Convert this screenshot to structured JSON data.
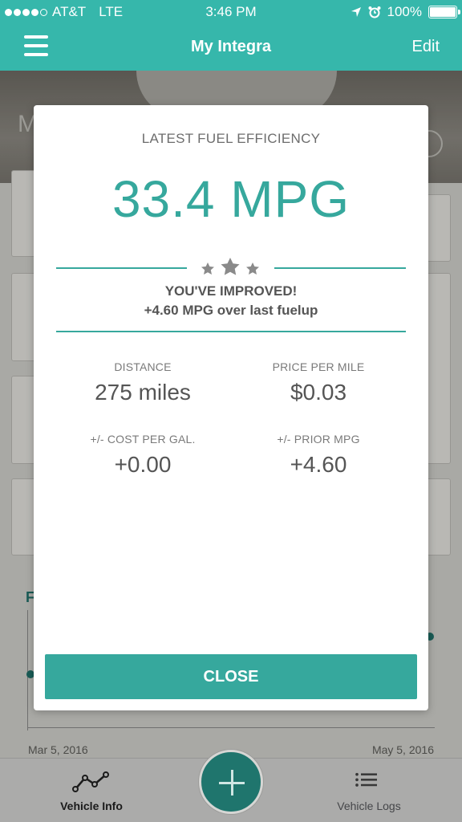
{
  "status_bar": {
    "carrier": "AT&T",
    "network": "LTE",
    "time": "3:46 PM",
    "battery": "100%",
    "location_icon": "location-arrow-icon",
    "alarm_icon": "alarm-icon"
  },
  "nav": {
    "title": "My Integra",
    "edit_label": "Edit",
    "menu_icon": "hamburger-menu-icon"
  },
  "background": {
    "hero_letter": "M",
    "chart_label": "F",
    "start_date": "Mar 5, 2016",
    "end_date": "May 5, 2016"
  },
  "modal": {
    "title": "LATEST FUEL EFFICIENCY",
    "mpg": "33.4 MPG",
    "rating_stars": 3,
    "improved_title": "YOU'VE IMPROVED!",
    "improved_detail": "+4.60 MPG over last fuelup",
    "stats": [
      {
        "label": "DISTANCE",
        "value": "275 miles"
      },
      {
        "label": "PRICE PER MILE",
        "value": "$0.03"
      },
      {
        "label": "+/- COST PER GAL.",
        "value": "+0.00"
      },
      {
        "label": "+/- PRIOR MPG",
        "value": "+4.60"
      }
    ],
    "close_label": "CLOSE"
  },
  "tabs": [
    {
      "label": "Vehicle Info",
      "icon": "graph-line-icon",
      "active": true
    },
    {
      "label": "Vehicle Logs",
      "icon": "list-icon",
      "active": false
    }
  ],
  "fab": {
    "icon": "plus-icon"
  },
  "colors": {
    "accent": "#36b7ab",
    "accent_dark": "#1f756d",
    "text_muted": "#6d6d6d"
  }
}
